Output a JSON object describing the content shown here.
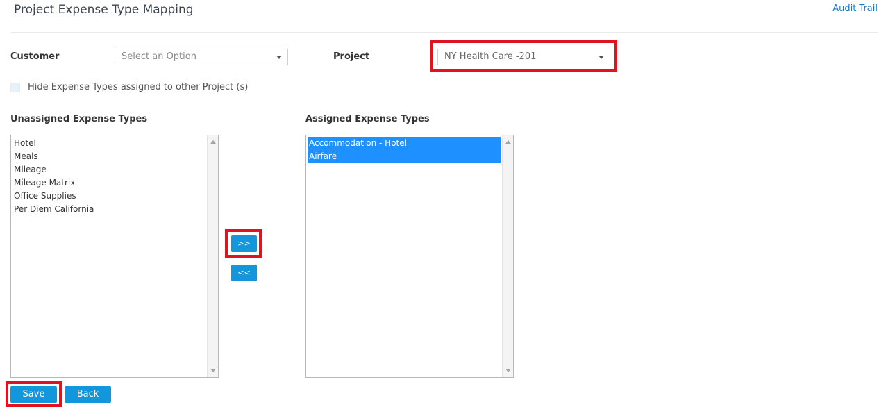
{
  "header": {
    "title": "Project Expense Type Mapping",
    "audit_trail": "Audit Trail"
  },
  "filters": {
    "customer_label": "Customer",
    "customer_placeholder": "Select an Option",
    "project_label": "Project",
    "project_value": "NY Health Care -201"
  },
  "options": {
    "hide_assigned_label": "Hide Expense Types assigned to other Project (s)"
  },
  "unassigned": {
    "title": "Unassigned Expense Types",
    "items": [
      "Hotel",
      "Meals",
      "Mileage",
      "Mileage Matrix",
      "Office Supplies",
      "Per Diem California"
    ]
  },
  "assigned": {
    "title": "Assigned Expense Types",
    "items": [
      "Accommodation - Hotel",
      "Airfare"
    ]
  },
  "transfer": {
    "add_label": ">>",
    "remove_label": "<<"
  },
  "actions": {
    "save_label": "Save",
    "back_label": "Back"
  },
  "colors": {
    "accent": "#1296dc",
    "selection": "#1e90ff",
    "highlight": "#e0141e"
  }
}
